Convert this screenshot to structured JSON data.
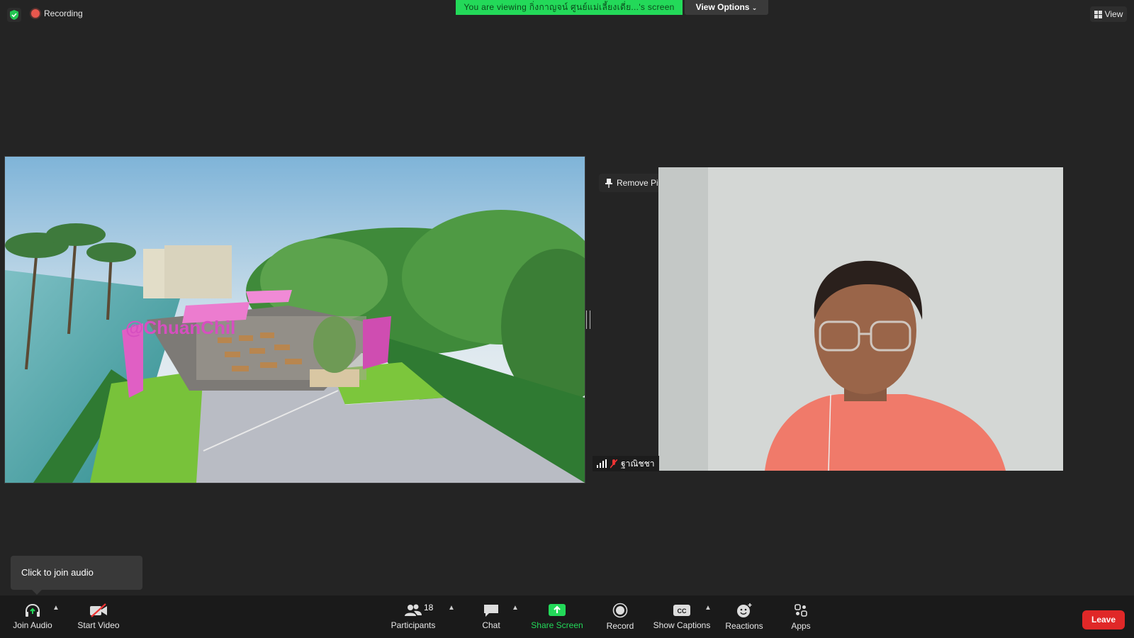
{
  "top": {
    "recording_label": "Recording",
    "banner_text": "You are viewing กิ่งกาญจน์ ศูนย์แม่เลี้ยงเดี่ย...'s screen",
    "view_options_label": "View Options",
    "view_label": "View"
  },
  "shared_screen": {
    "watermark_text": "@ChuanChil"
  },
  "participant": {
    "remove_pin_label": "Remove Pin",
    "name": "ฐาณิชชา"
  },
  "tooltip": {
    "text": "Click to join audio"
  },
  "toolbar": {
    "join_audio": "Join Audio",
    "start_video": "Start Video",
    "participants": "Participants",
    "participants_count": "18",
    "chat": "Chat",
    "share_screen": "Share Screen",
    "record": "Record",
    "show_captions": "Show Captions",
    "reactions": "Reactions",
    "apps": "Apps",
    "leave": "Leave"
  },
  "colors": {
    "banner_green": "#23d959",
    "leave_red": "#e02828",
    "background": "#242424",
    "toolbar": "#1a1a1a"
  }
}
